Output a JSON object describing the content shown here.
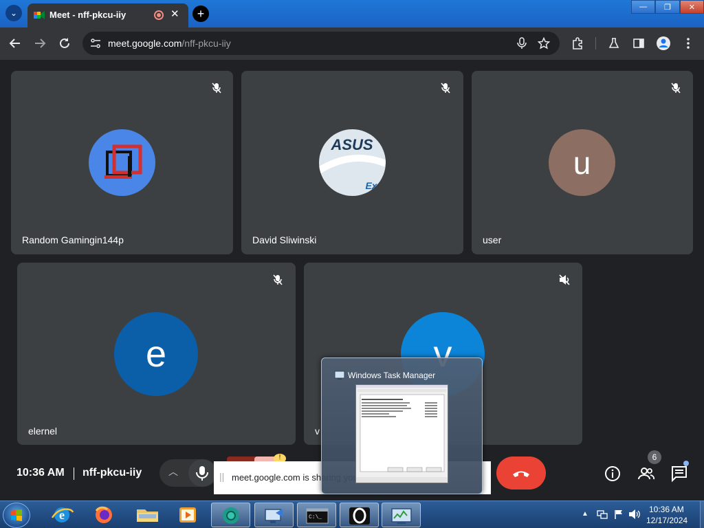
{
  "browser": {
    "tab_title": "Meet - nff-pkcu-iiy",
    "tab_close": "✕",
    "new_tab": "+",
    "url_host": "meet.google.com",
    "url_path": "/nff-pkcu-iiy",
    "window_buttons": [
      "—",
      "❐",
      "✕"
    ]
  },
  "participants": [
    {
      "name": "Random Gamingin144p",
      "avatar_letter": "",
      "avatar_color": "#4a86e8"
    },
    {
      "name": "David Sliwinski",
      "avatar_letter": "",
      "avatar_color": "#dfe7ee"
    },
    {
      "name": "user",
      "avatar_letter": "u",
      "avatar_color": "#8d6e63"
    },
    {
      "name": "elernel",
      "avatar_letter": "e",
      "avatar_color": "#0b5ea8"
    },
    {
      "name": "v",
      "avatar_letter": "v",
      "avatar_color": "#0c84d8"
    }
  ],
  "meeting": {
    "time": "10:36 AM",
    "code": "nff-pkcu-iiy",
    "people_count": "6",
    "share_notice": "meet.google.com is sharing your screen."
  },
  "task_manager_popup": {
    "title": "Windows Task Manager"
  },
  "taskbar": {
    "apps": [
      "internet-explorer",
      "firefox",
      "file-explorer",
      "media-player",
      "chrome-meet",
      "remote-desktop",
      "command-prompt",
      "opera",
      "task-manager"
    ],
    "clock_time": "10:36 AM",
    "clock_date": "12/17/2024"
  },
  "colors": {
    "meet_bg": "#202124",
    "tile_bg": "#3c4043",
    "end_call": "#ea4335",
    "taskbar": "#1f4a82"
  }
}
